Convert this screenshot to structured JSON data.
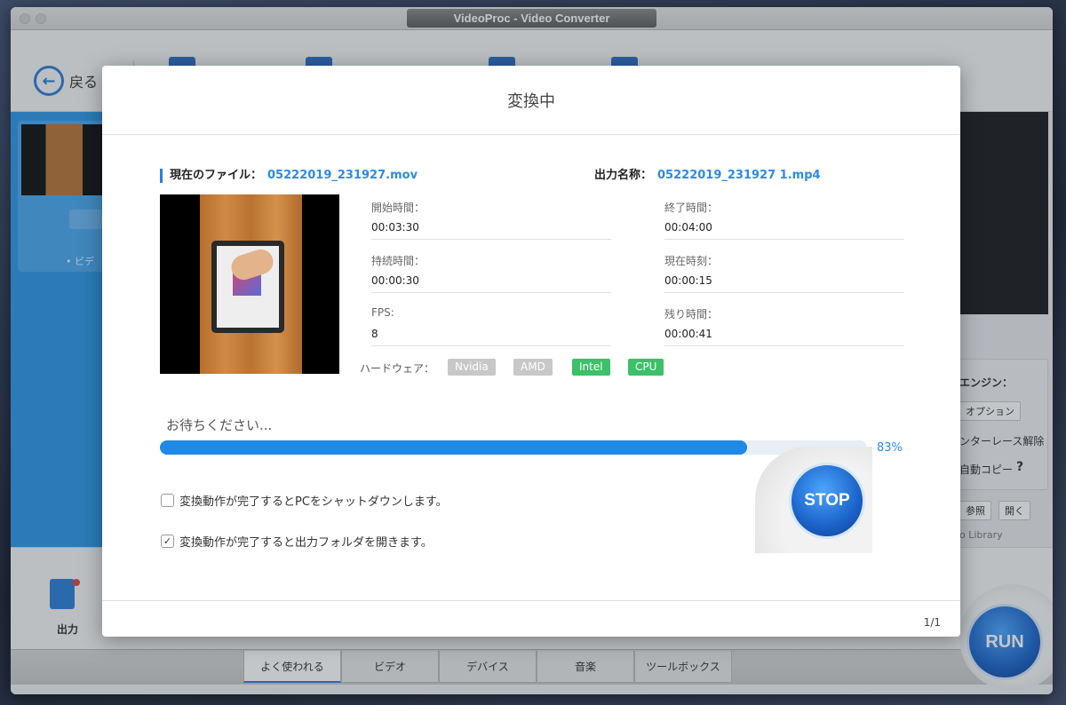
{
  "window": {
    "title": "VideoProc - Video Converter"
  },
  "toolbar": {
    "back_label": "戻る"
  },
  "left_panel": {
    "item_label": "• ビデ"
  },
  "right_panel": {
    "engine_label": "エンジン：",
    "option_button": "オプション",
    "deinterlace": "ンターレース解除",
    "auto_copy": "自動コピー",
    "help": "?",
    "browse_button": "参照",
    "open_button": "開く",
    "library_text": "o Library"
  },
  "bottom": {
    "output_label": "出力",
    "tabs": [
      {
        "label": "よく使われる",
        "active": true
      },
      {
        "label": "ビデオ",
        "active": false
      },
      {
        "label": "デバイス",
        "active": false
      },
      {
        "label": "音楽",
        "active": false
      },
      {
        "label": "ツールボックス",
        "active": false
      }
    ],
    "run_label": "RUN"
  },
  "dialog": {
    "title": "変換中",
    "current_file_label": "現在のファイル：",
    "current_file": "05222019_231927.mov",
    "output_name_label": "出力名称：",
    "output_name": "05222019_231927 1.mp4",
    "info": {
      "start_time_label": "開始時間：",
      "start_time": "00:03:30",
      "end_time_label": "終了時間：",
      "end_time": "00:04:00",
      "duration_label": "持続時間：",
      "duration": "00:00:30",
      "current_time_label": "現在時刻：",
      "current_time": "00:00:15",
      "fps_label": "FPS:",
      "fps": "8",
      "remaining_label": "残り時間：",
      "remaining": "00:00:41"
    },
    "hardware_label": "ハードウェア：",
    "hardware": [
      {
        "name": "Nvidia",
        "active": false
      },
      {
        "name": "AMD",
        "active": false
      },
      {
        "name": "Intel",
        "active": true
      },
      {
        "name": "CPU",
        "active": true
      }
    ],
    "wait_text": "お待ちください...",
    "progress": 0.83,
    "progress_text": "83%",
    "shutdown_option": {
      "label": "変換動作が完了するとPCをシャットダウンします。",
      "checked": false
    },
    "open_folder_option": {
      "label": "変換動作が完了すると出力フォルダを開きます。",
      "checked": true
    },
    "stop_label": "STOP",
    "page_count": "1/1"
  },
  "colors": {
    "accent": "#2d8ae8",
    "hw_active": "#3cc068",
    "hw_inactive": "#c8c8c8"
  },
  "icons": {
    "back": "arrow-left-icon",
    "check": "checkmark-icon",
    "output": "document-gear-icon"
  }
}
